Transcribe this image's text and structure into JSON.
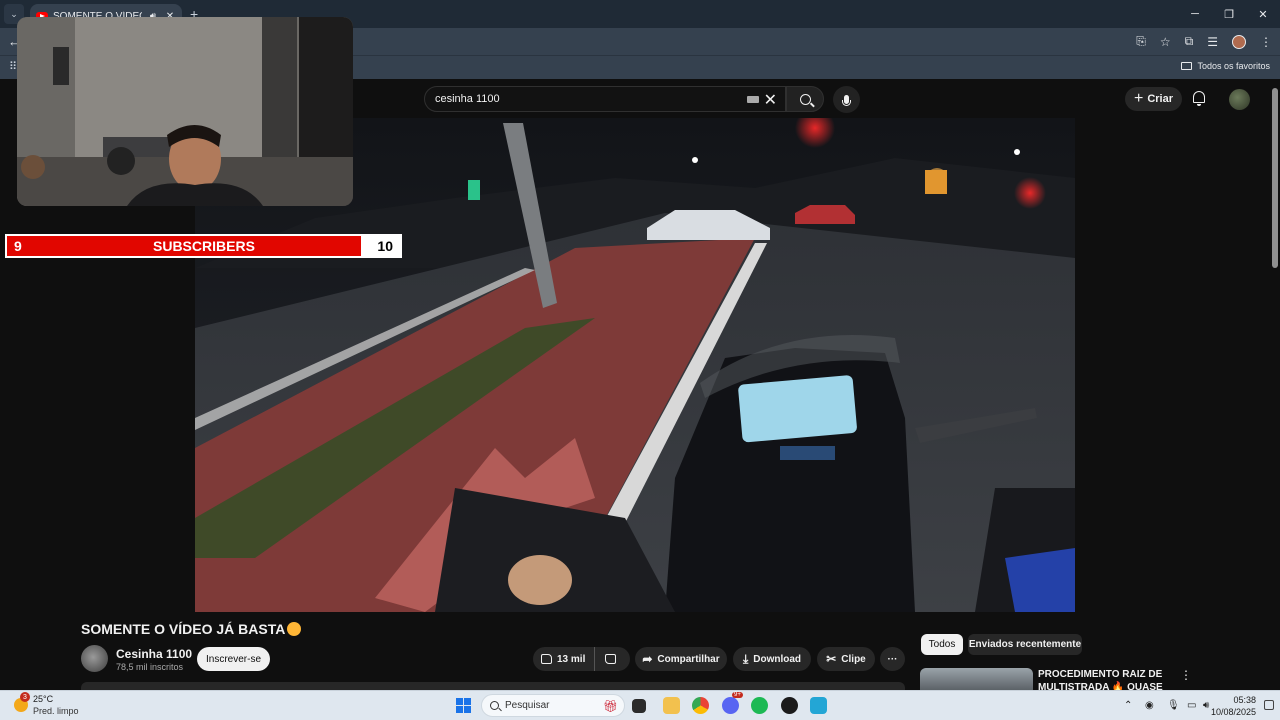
{
  "browser": {
    "tab_title": "SOMENTE O VÍDEO JÁ BASTA",
    "tab_close": "✕",
    "new_tab": "+",
    "bookmarks_all": "Todos os favoritos"
  },
  "search": {
    "query": "cesinha 1100"
  },
  "header": {
    "create_label": "Criar"
  },
  "overlay": {
    "subscribers_current": "9",
    "subscribers_label": "SUBSCRIBERS",
    "subscribers_goal": "10",
    "progress_fraction": 0.9
  },
  "video": {
    "title": "SOMENTE O VÍDEO JÁ BASTA",
    "channel_name": "Cesinha 1100",
    "channel_subs": "78,5 mil inscritos",
    "subscribe_label": "Inscrever-se",
    "likes": "13 mil",
    "share_label": "Compartilhar",
    "download_label": "Download",
    "clip_label": "Clipe",
    "more_label": "···"
  },
  "sidebar": {
    "chip_all": "Todos",
    "chip_recent": "Enviados recentemente",
    "rec_title": "PROCEDIMENTO RAIZ DE MULTISTRADA 🔥 QUASE PEU"
  },
  "taskbar": {
    "weather_temp": "25°C",
    "weather_desc": "Pred. limpo",
    "weather_badge": "3",
    "search_placeholder": "Pesquisar",
    "time": "05:38",
    "date": "10/08/2025",
    "discord_badge": "9+"
  },
  "colors": {
    "youtube_red": "#ff0000",
    "subscriber_bar_red": "#e10600",
    "background": "#0f0f0f"
  }
}
